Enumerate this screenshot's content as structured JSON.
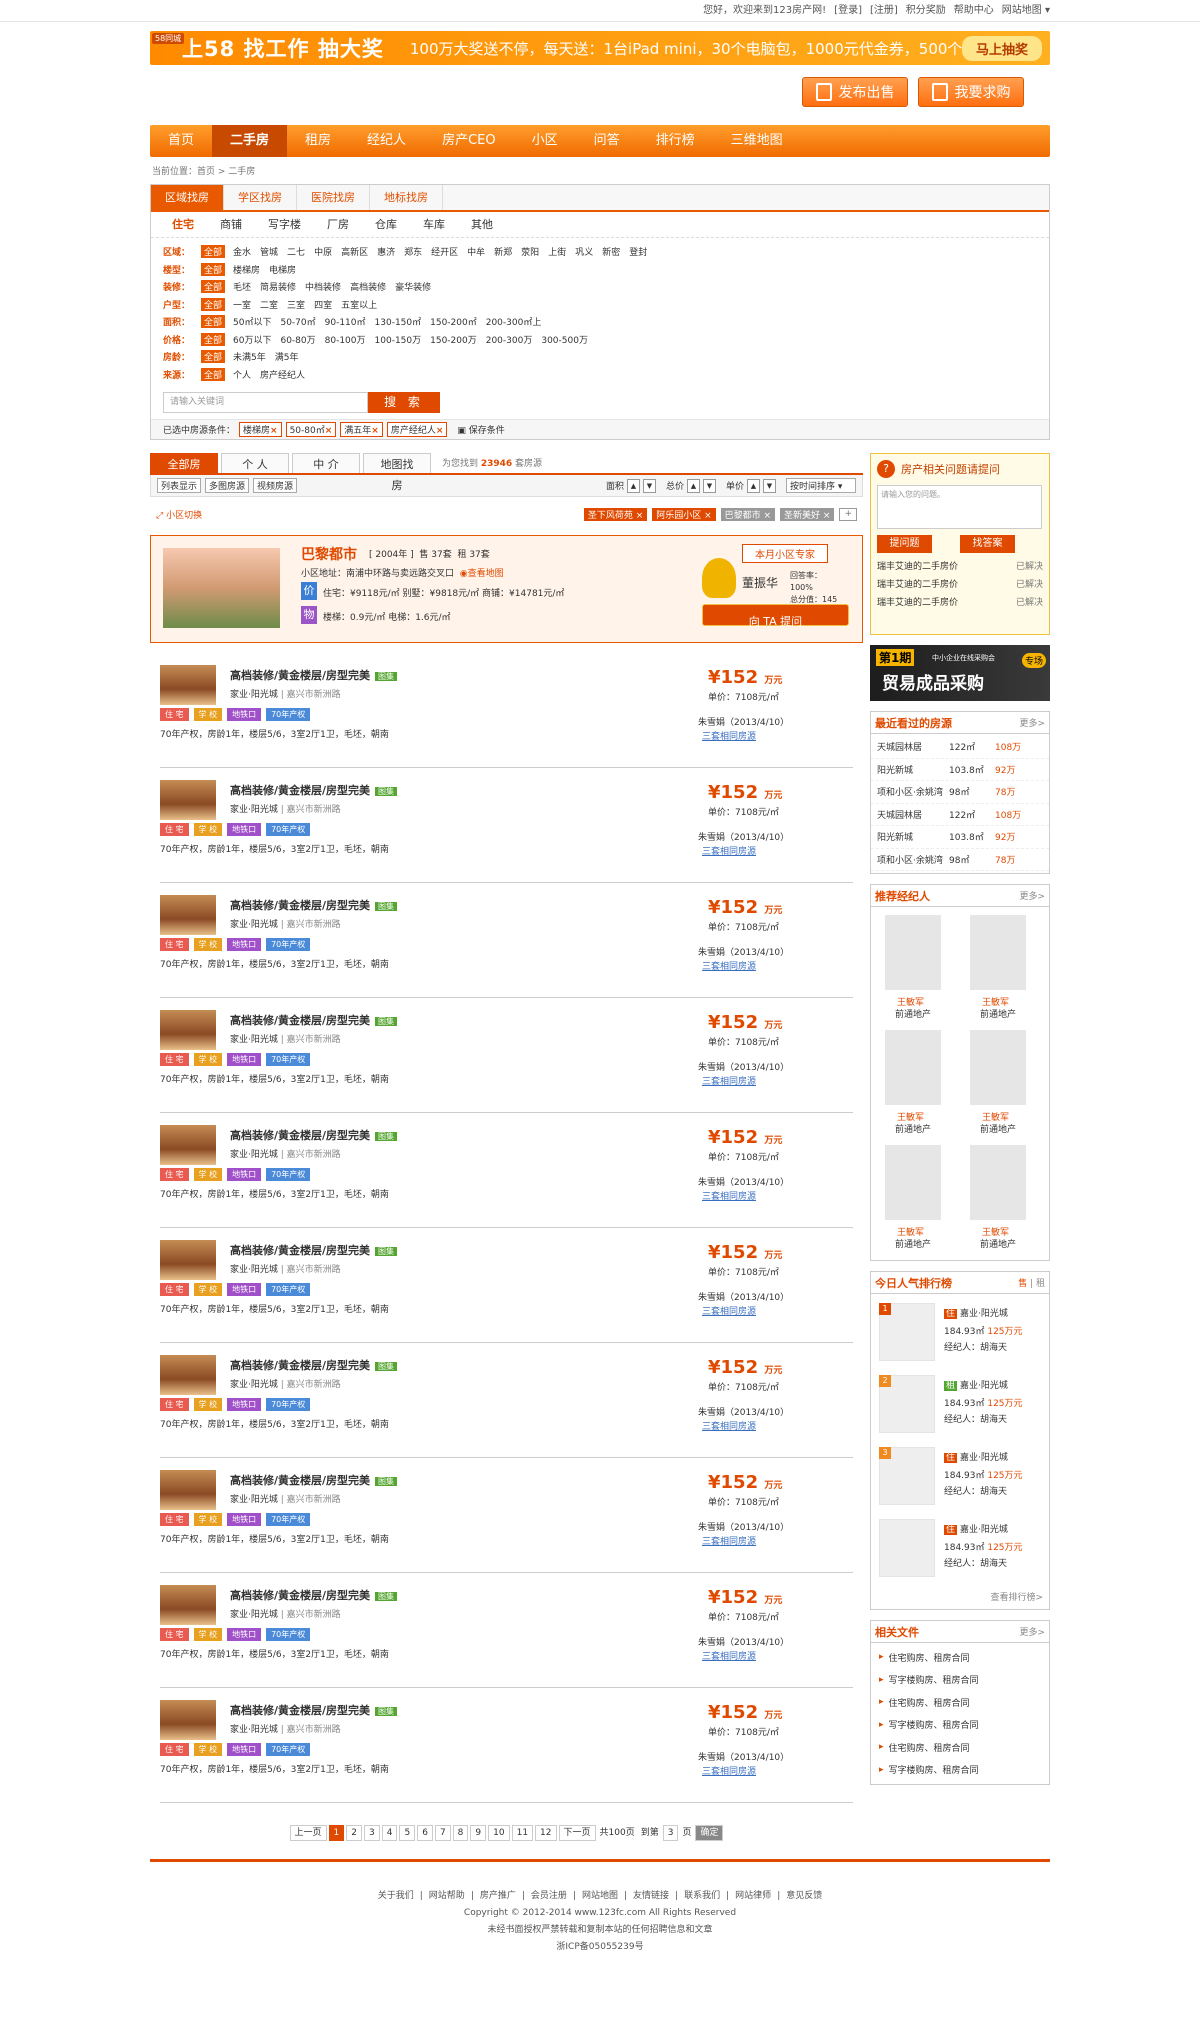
{
  "topbar": [
    "您好，欢迎来到123房产网!",
    "[登录]",
    "[注册]",
    "积分奖励",
    "帮助中心",
    "网站地图 ▾"
  ],
  "banner": {
    "tag": "58同城",
    "big": "上58 找工作 抽大奖",
    "sub": "100万大奖送不停，每天送：1台iPad mini，30个电脑包，1000元代金券，500个Q币",
    "cta": "马上抽奖"
  },
  "post": {
    "sell": "发布出售",
    "buy": "我要求购"
  },
  "nav": [
    "首页",
    "二手房",
    "租房",
    "经纪人",
    "房产CEO",
    "小区",
    "问答",
    "排行榜",
    "三维地图"
  ],
  "crumb": "当前位置：首页 > 二手房",
  "stabs": [
    "区域找房",
    "学区找房",
    "医院找房",
    "地标找房"
  ],
  "ctype": [
    "住宅",
    "商铺",
    "写字楼",
    "厂房",
    "仓库",
    "车库",
    "其他"
  ],
  "filters": [
    {
      "label": "区域：",
      "all": "全部",
      "opts": [
        "金水",
        "管城",
        "二七",
        "中原",
        "高新区",
        "惠济",
        "郑东",
        "经开区",
        "中牟",
        "新郑",
        "荥阳",
        "上街",
        "巩义",
        "新密",
        "登封"
      ]
    },
    {
      "label": "楼型：",
      "all": "全部",
      "opts": [
        "楼梯房",
        "电梯房"
      ]
    },
    {
      "label": "装修：",
      "all": "全部",
      "opts": [
        "毛坯",
        "简易装修",
        "中档装修",
        "高档装修",
        "豪华装修"
      ]
    },
    {
      "label": "户型：",
      "all": "全部",
      "opts": [
        "一室",
        "二室",
        "三室",
        "四室",
        "五室以上"
      ]
    },
    {
      "label": "面积：",
      "all": "全部",
      "opts": [
        "50㎡以下",
        "50-70㎡",
        "90-110㎡",
        "130-150㎡",
        "150-200㎡",
        "200-300㎡上"
      ]
    },
    {
      "label": "价格：",
      "all": "全部",
      "opts": [
        "60万以下",
        "60-80万",
        "80-100万",
        "100-150万",
        "150-200万",
        "200-300万",
        "300-500万"
      ]
    },
    {
      "label": "房龄：",
      "all": "全部",
      "opts": [
        "未满5年",
        "满5年"
      ]
    },
    {
      "label": "来源：",
      "all": "全部",
      "opts": [
        "个人",
        "房产经纪人"
      ]
    }
  ],
  "search": {
    "placeholder": "请输入关键词",
    "btn": "搜 索"
  },
  "chosen": {
    "label": "已选中房源条件：",
    "items": [
      "楼梯房",
      "50-80㎡",
      "满五年",
      "房产经纪人"
    ],
    "save": "保存条件"
  },
  "ltabs": [
    "全部房源",
    "个 人",
    "中 介",
    "地图找房"
  ],
  "found": {
    "pre": "为您找到",
    "num": "23946",
    "post": "套房源"
  },
  "lbar": {
    "views": [
      "列表显示",
      "多图房源",
      "视频房源"
    ],
    "sorts": [
      "面积",
      "总价",
      "单价"
    ],
    "sel": "按时间排序"
  },
  "qrow": {
    "switch": "小区切换",
    "chips": [
      {
        "t": "圣下风荷苑",
        "c": "#e04a00"
      },
      {
        "t": "阿乐园小区",
        "c": "#e04a00"
      },
      {
        "t": "巴黎都市",
        "c": "#999999"
      },
      {
        "t": "圣新美好",
        "c": "#999999"
      }
    ]
  },
  "card": {
    "name": "巴黎都市",
    "year": "[ 2004年 ]",
    "sale": "售 37套",
    "rent": "租 37套",
    "addr": "小区地址：南浦中环路与卖远路交叉口",
    "map": "查看地图",
    "pv": "价",
    "wu": "物",
    "price": "住宅：¥9118元/㎡    别墅：¥9818元/㎡    商铺：¥14781元/㎡",
    "fee": "楼梯：0.9元/㎡    电梯：1.6元/㎡",
    "exp": {
      "title": "本月小区专家",
      "name": "董振华",
      "stat1": "回答率：100%",
      "stat2": "总分值：145",
      "ask": "向 TA 提问"
    }
  },
  "listing": {
    "title": "高档装修/黄金楼层/房型完美",
    "badge": "图集",
    "comm": "家业·阳光城",
    "addr": "嘉兴市新洲路",
    "tags": [
      {
        "t": "住 宅",
        "c": "#e95a50"
      },
      {
        "t": "学 校",
        "c": "#e8a020"
      },
      {
        "t": "地铁口",
        "c": "#a050c8"
      },
      {
        "t": "70年产权",
        "c": "#4a8ad8"
      }
    ],
    "info": "70年产权，房龄1年，楼层5/6，3室2厅1卫，毛坯，朝南",
    "price": "¥152",
    "unit": "万元",
    "up": "单价：7108元/㎡",
    "agent": "朱雪娟（2013/4/10）",
    "same": "三套相同房源"
  },
  "pager": {
    "prev": "上一页",
    "pages": [
      "1",
      "2",
      "3",
      "4",
      "5",
      "6",
      "7",
      "8",
      "9",
      "10",
      "11",
      "12"
    ],
    "next": "下一页",
    "total": "共100页",
    "goto": "到第",
    "cur": "3",
    "pg": "页",
    "go": "确定"
  },
  "ask": {
    "title": "房产相关问题请提问",
    "ph": "请输入您的问题。",
    "b1": "提问题",
    "b2": "找答案",
    "qs": [
      "瑞丰艾迪的二手房价",
      "瑞丰艾迪的二手房价",
      "瑞丰艾迪的二手房价"
    ],
    "st": "已解决"
  },
  "ad2": {
    "n": "第1期",
    "s": "中小企业在线采购会",
    "t": "贸易成品采购",
    "r": "专场"
  },
  "recent": {
    "title": "最近看过的房源",
    "more": "更多>",
    "rows": [
      [
        "天城园林居",
        "122㎡",
        "108万"
      ],
      [
        "阳光新城",
        "103.8㎡",
        "92万"
      ],
      [
        "项和小区·余姚湾",
        "98㎡",
        "78万"
      ],
      [
        "天城园林居",
        "122㎡",
        "108万"
      ],
      [
        "阳光新城",
        "103.8㎡",
        "92万"
      ],
      [
        "项和小区·余姚湾",
        "98㎡",
        "78万"
      ]
    ]
  },
  "agents": {
    "title": "推荐经纪人",
    "more": "更多>",
    "name": "王敏军",
    "co": "前通地产",
    "count": 6
  },
  "rank": {
    "title": "今日人气排行榜",
    "tab1": "售",
    "tab2": "租",
    "items": [
      {
        "n": "1",
        "t": "住",
        "c": "#e04a00"
      },
      {
        "n": "2",
        "t": "租",
        "c": "#54a630"
      },
      {
        "n": "3",
        "t": "住",
        "c": "#e04a00"
      },
      {
        "n": "",
        "t": "住",
        "c": "#e04a00"
      }
    ],
    "name": "嘉业·阳光城",
    "area": "184.93㎡",
    "price": "125万元",
    "agent": "经纪人：胡海天",
    "more": "查看排行榜>"
  },
  "docs": {
    "title": "相关文件",
    "more": "更多>",
    "items": [
      "住宅购房、租房合同",
      "写字楼购房、租房合同",
      "住宅购房、租房合同",
      "写字楼购房、租房合同",
      "住宅购房、租房合同",
      "写字楼购房、租房合同"
    ]
  },
  "foot": {
    "links": [
      "关于我们",
      "网站帮助",
      "房产推广",
      "会员注册",
      "网站地图",
      "友情链接",
      "联系我们",
      "网站律师",
      "意见反馈"
    ],
    "copy": "Copyright © 2012-2014 www.123fc.com All Rights Reserved",
    "l2": "未经书面授权严禁转载和复制本站的任何招聘信息和文章",
    "icp": "浙ICP备05055239号"
  }
}
